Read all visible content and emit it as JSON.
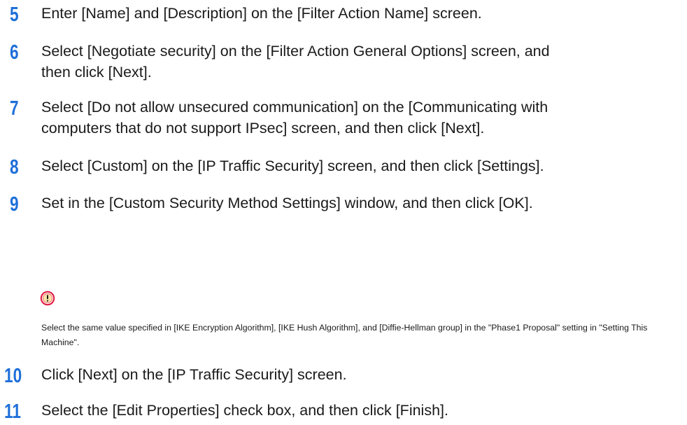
{
  "steps": [
    {
      "num": "5",
      "text": "Enter [Name] and [Description] on the [Filter Action Name] screen."
    },
    {
      "num": "6",
      "text": "Select [Negotiate security] on the [Filter Action General Options] screen, and then click [Next]."
    },
    {
      "num": "7",
      "text": "Select [Do not allow unsecured communication] on the [Communicating with computers that do not support IPsec] screen, and then click [Next]."
    },
    {
      "num": "8",
      "text": "Select [Custom] on the [IP Traffic Security] screen, and then click [Settings]."
    },
    {
      "num": "9",
      "text": "Set in the [Custom Security Method Settings] window, and then click [OK]."
    },
    {
      "num": "10",
      "text": "Click [Next] on the [IP Traffic Security] screen."
    },
    {
      "num": "11",
      "text": "Select the [Edit Properties] check box, and then click [Finish]."
    }
  ],
  "note": {
    "icon": "caution-icon",
    "icon_color": "#e0143c",
    "text": "Select the same value specified in [IKE Encryption Algorithm], [IKE Hush Algorithm], and [Diffie-Hellman group] in the \"Phase1 Proposal\" setting in \"Setting This Machine\"."
  },
  "colors": {
    "step_number": "#1e6fd9",
    "body_text": "#1a1a1a"
  }
}
